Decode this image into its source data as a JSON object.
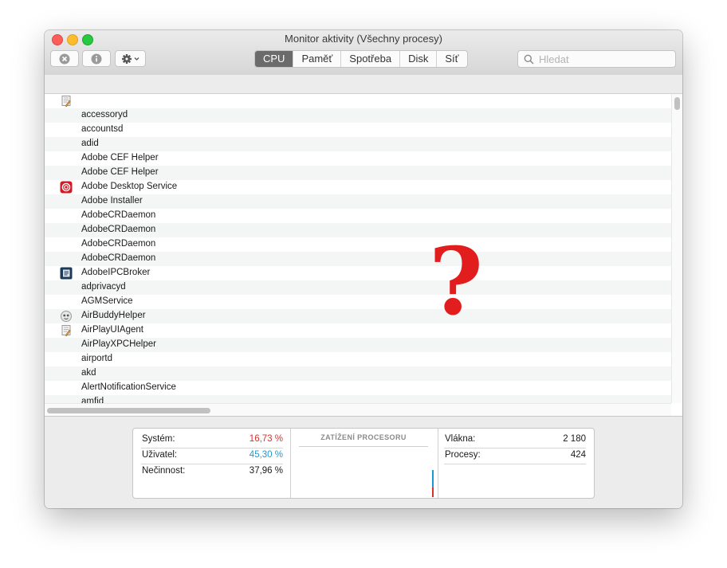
{
  "window": {
    "title": "Monitor aktivity (Všechny procesy)"
  },
  "toolbar": {
    "stop_icon": "stop-process-icon",
    "info_icon": "info-icon",
    "gear_icon": "gear-icon",
    "tabs": [
      "CPU",
      "Paměť",
      "Spotřeba",
      "Disk",
      "Síť"
    ],
    "active_tab": "CPU",
    "search_placeholder": "Hledat"
  },
  "processes": [
    {
      "name": "",
      "icon": "generic-app-icon"
    },
    {
      "name": "accessoryd",
      "icon": ""
    },
    {
      "name": "accountsd",
      "icon": ""
    },
    {
      "name": "adid",
      "icon": ""
    },
    {
      "name": "Adobe CEF Helper",
      "icon": ""
    },
    {
      "name": "Adobe CEF Helper",
      "icon": ""
    },
    {
      "name": "Adobe Desktop Service",
      "icon": "adobe-cc-icon"
    },
    {
      "name": "Adobe Installer",
      "icon": ""
    },
    {
      "name": "AdobeCRDaemon",
      "icon": ""
    },
    {
      "name": "AdobeCRDaemon",
      "icon": ""
    },
    {
      "name": "AdobeCRDaemon",
      "icon": ""
    },
    {
      "name": "AdobeCRDaemon",
      "icon": ""
    },
    {
      "name": "AdobeIPCBroker",
      "icon": "adobe-ipc-icon"
    },
    {
      "name": "adprivacyd",
      "icon": ""
    },
    {
      "name": "AGMService",
      "icon": ""
    },
    {
      "name": "AirBuddyHelper",
      "icon": "airbuddy-icon"
    },
    {
      "name": "AirPlayUIAgent",
      "icon": "generic-app-icon"
    },
    {
      "name": "AirPlayXPCHelper",
      "icon": ""
    },
    {
      "name": "airportd",
      "icon": ""
    },
    {
      "name": "akd",
      "icon": ""
    },
    {
      "name": "AlertNotificationService",
      "icon": ""
    },
    {
      "name": "amfid",
      "icon": ""
    }
  ],
  "overlay": {
    "mark": "?",
    "color": "#e21d1d"
  },
  "stats": {
    "system_label": "Systém:",
    "system_value": "16,73 %",
    "system_color": "#d9322d",
    "user_label": "Uživatel:",
    "user_value": "45,30 %",
    "user_color": "#1c9ad6",
    "idle_label": "Nečinnost:",
    "idle_value": "37,96 %",
    "graph_title": "ZATÍŽENÍ PROCESORU",
    "threads_label": "Vlákna:",
    "threads_value": "2 180",
    "processes_label": "Procesy:",
    "processes_value": "424"
  }
}
